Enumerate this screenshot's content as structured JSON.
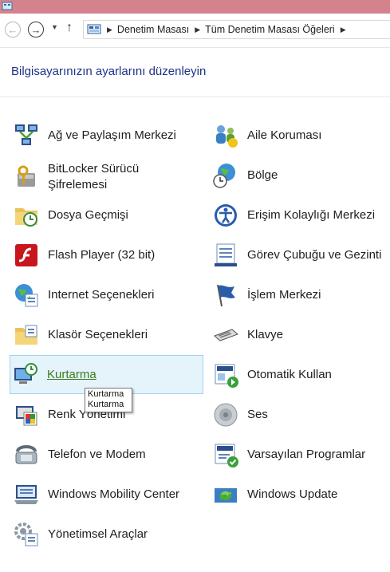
{
  "window": {
    "title_bar_color": "#d4828e"
  },
  "nav": {
    "back_label": "←",
    "forward_label": "→",
    "recent_label": "▼",
    "up_label": "↑"
  },
  "breadcrumb": {
    "separator": "▶",
    "items": [
      "Denetim Masası",
      "Tüm Denetim Masası Öğeleri"
    ]
  },
  "page": {
    "title": "Bilgisayarınızın ayarlarını düzenleyin"
  },
  "items": [
    {
      "label": "Ağ ve Paylaşım Merkezi",
      "icon": "network-sharing-icon"
    },
    {
      "label": "Aile Koruması",
      "icon": "family-safety-icon"
    },
    {
      "label": "BitLocker Sürücü\nŞifrelemesi",
      "icon": "bitlocker-icon"
    },
    {
      "label": "Bölge",
      "icon": "region-icon"
    },
    {
      "label": "Dosya Geçmişi",
      "icon": "file-history-icon"
    },
    {
      "label": "Erişim Kolaylığı Merkezi",
      "icon": "ease-of-access-icon"
    },
    {
      "label": "Flash Player (32 bit)",
      "icon": "flash-player-icon"
    },
    {
      "label": "Görev Çubuğu ve Gezinti",
      "icon": "taskbar-icon"
    },
    {
      "label": "Internet Seçenekleri",
      "icon": "internet-options-icon"
    },
    {
      "label": "İşlem Merkezi",
      "icon": "action-center-icon"
    },
    {
      "label": "Klasör Seçenekleri",
      "icon": "folder-options-icon"
    },
    {
      "label": "Klavye",
      "icon": "keyboard-icon"
    },
    {
      "label": "Kurtarma",
      "icon": "recovery-icon"
    },
    {
      "label": "Otomatik Kullan",
      "icon": "autoplay-icon"
    },
    {
      "label": "Renk Yönetimi",
      "icon": "color-management-icon"
    },
    {
      "label": "Ses",
      "icon": "sound-icon"
    },
    {
      "label": "Telefon ve Modem",
      "icon": "phone-modem-icon"
    },
    {
      "label": "Varsayılan Programlar",
      "icon": "default-programs-icon"
    },
    {
      "label": "Windows Mobility Center",
      "icon": "mobility-center-icon"
    },
    {
      "label": "Windows Update",
      "icon": "windows-update-icon"
    },
    {
      "label": "Yönetimsel Araçlar",
      "icon": "admin-tools-icon"
    }
  ],
  "tooltip": {
    "line1": "Kurtarma",
    "line2": "Kurtarma"
  }
}
